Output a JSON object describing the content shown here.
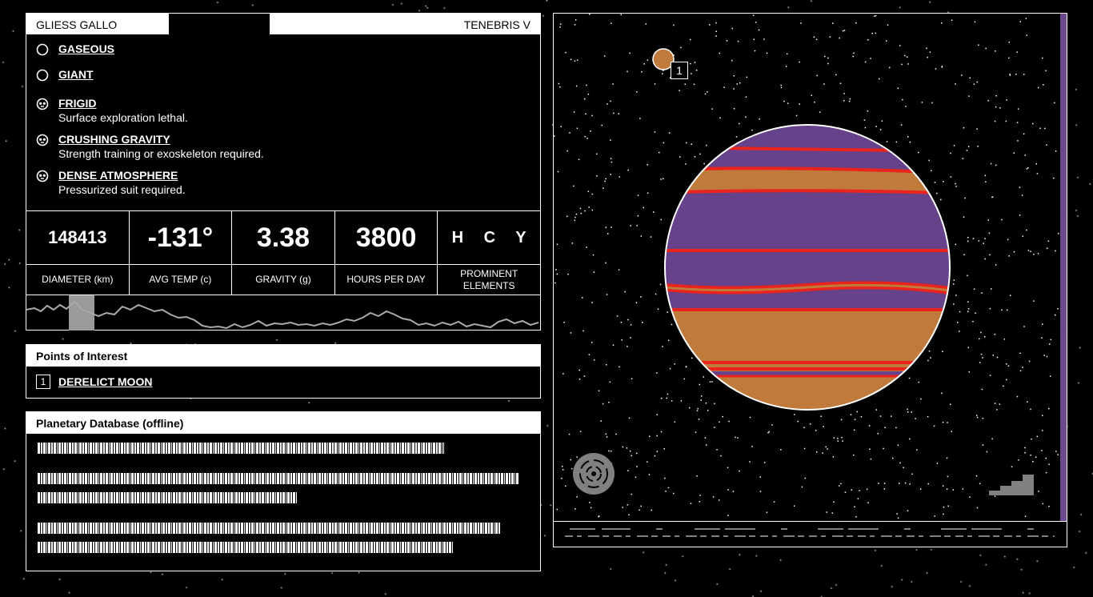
{
  "header": {
    "system_name": "GLIESS GALLO",
    "planet_name": "TENEBRIS V"
  },
  "traits": [
    {
      "icon": "circle-icon",
      "name": "GASEOUS",
      "description": ""
    },
    {
      "icon": "circle-icon",
      "name": "GIANT",
      "description": ""
    },
    {
      "icon": "skull-icon",
      "name": "FRIGID",
      "description": "Surface exploration lethal."
    },
    {
      "icon": "skull-icon",
      "name": "CRUSHING GRAVITY",
      "description": "Strength training or exoskeleton required."
    },
    {
      "icon": "skull-icon",
      "name": "DENSE ATMOSPHERE",
      "description": "Pressurized suit required."
    }
  ],
  "stats": [
    {
      "value": "148413",
      "label": "DIAMETER (km)"
    },
    {
      "value": "-131°",
      "label": "AVG TEMP (c)"
    },
    {
      "value": "3.38",
      "label": "GRAVITY (g)"
    },
    {
      "value": "3800",
      "label": "HOURS PER DAY"
    },
    {
      "value": "H C Y",
      "label": "PROMINENT ELEMENTS"
    }
  ],
  "points_of_interest": {
    "title": "Points of Interest",
    "items": [
      {
        "number": "1",
        "label": "DERELICT MOON"
      }
    ]
  },
  "database": {
    "title": "Planetary Database (offline)"
  },
  "viewer": {
    "moon_marker": "1"
  },
  "colors": {
    "purple": "#65428a",
    "orange": "#bf7a3c",
    "red": "#e8241d",
    "scroll": "#6a4a8c"
  }
}
